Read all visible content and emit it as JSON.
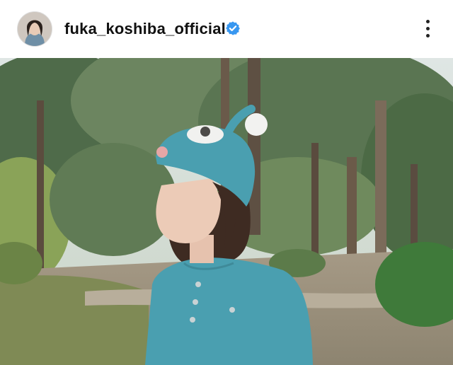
{
  "post": {
    "username": "fuka_koshiba_official",
    "verified": true,
    "verified_icon": "verified-badge-icon",
    "more_icon": "more-vertical-icon",
    "image_subject": "woman in blue knit beanie and cardigan in park"
  },
  "colors": {
    "verified_blue": "#3897f0",
    "text": "#111111",
    "knit_blue": "#4a9fb0"
  }
}
